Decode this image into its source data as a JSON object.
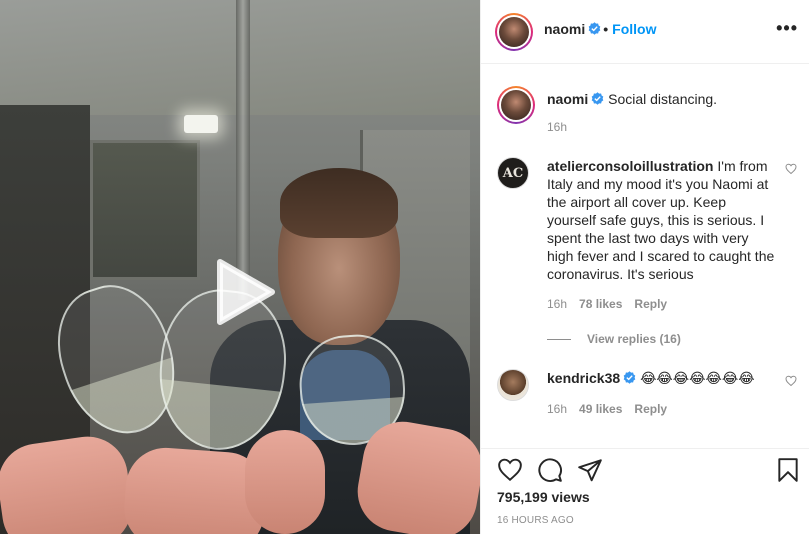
{
  "post": {
    "username": "naomi",
    "follow_label": "Follow",
    "separator": "•",
    "more_label": "•••",
    "caption": "Social distancing.",
    "caption_age": "16h"
  },
  "comments": [
    {
      "username": "atelierconsoloillustration",
      "avatar_text": "AC",
      "text": "I'm from Italy and my mood it's you Naomi at the airport all cover up. Keep yourself safe guys, this is serious. I spent the last two days with very high fever and I scared to caught the coronavirus. It's serious",
      "age": "16h",
      "likes": "78 likes",
      "reply_label": "Reply",
      "view_replies": "View replies (16)"
    },
    {
      "username": "kendrick38",
      "text": "😂😂😂😂😂😂😂",
      "age": "16h",
      "likes": "49 likes",
      "reply_label": "Reply"
    }
  ],
  "footer": {
    "views": "795,199 views",
    "timestamp": "16 HOURS AGO"
  },
  "colors": {
    "accent": "#0095f6",
    "text": "#262626",
    "muted": "#8e8e8e",
    "border": "#efefef"
  },
  "icons": {
    "verified": "verified-badge-icon",
    "like": "heart-icon",
    "comment": "comment-icon",
    "share": "share-icon",
    "save": "bookmark-icon",
    "play": "play-icon",
    "more": "more-icon"
  }
}
